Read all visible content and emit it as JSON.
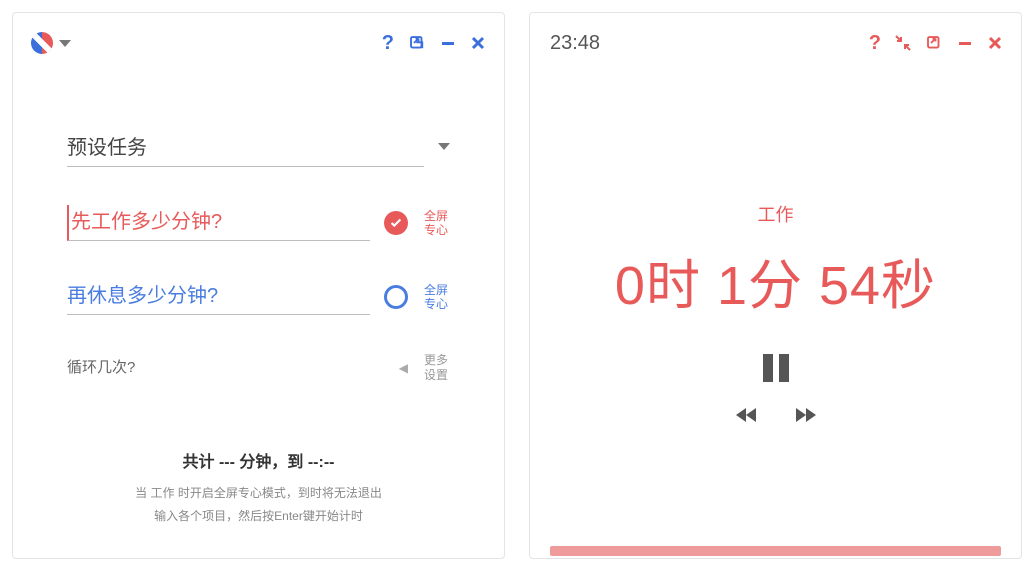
{
  "colors": {
    "blue": "#3b6fdc",
    "red": "#e85a5a",
    "gray": "#555"
  },
  "leftPanel": {
    "presetTask": {
      "label": "预设任务"
    },
    "workMinutes": {
      "placeholder": "先工作多少分钟?",
      "checked": true,
      "sideLabel": "全屏\n专心"
    },
    "restMinutes": {
      "placeholder": "再休息多少分钟?",
      "checked": false,
      "sideLabel": "全屏\n专心"
    },
    "loopCount": {
      "placeholder": "循环几次?",
      "sideLabel": "更多\n设置"
    },
    "footer": {
      "total": "共计 --- 分钟，到 --:--",
      "hint1": "当 工作 时开启全屏专心模式，到时将无法退出",
      "hint2": "输入各个项目，然后按Enter键开始计时"
    }
  },
  "rightPanel": {
    "clock": "23:48",
    "timer": {
      "label": "工作",
      "display": "0时 1分 54秒"
    }
  }
}
